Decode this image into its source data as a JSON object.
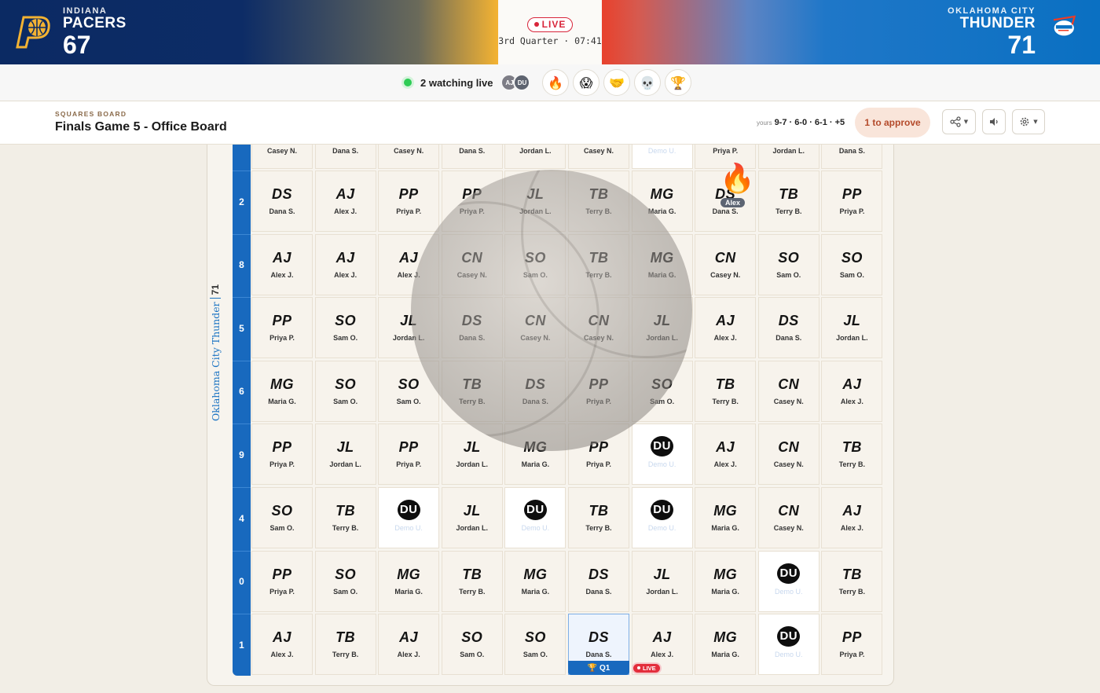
{
  "scoreboard": {
    "home": {
      "city": "INDIANA",
      "name": "PACERS",
      "score": "67",
      "logo_icon": "pacers-logo-icon"
    },
    "away": {
      "city": "OKLAHOMA CITY",
      "name": "THUNDER",
      "score": "71",
      "logo_icon": "thunder-logo-icon"
    },
    "status": "LIVE",
    "period_clock": "3rd Quarter · 07:41"
  },
  "presence": {
    "watching_text": "2 watching live",
    "avatars": [
      "AJ",
      "DU"
    ],
    "reactions": [
      "🔥",
      "😱",
      "🤝",
      "💀",
      "🏆"
    ]
  },
  "header": {
    "eyebrow": "SQUARES BOARD",
    "title": "Finals Game 5 - Office Board",
    "yours_label": "yours",
    "yours_numbers": "9-7 · 6-0 · 6-1 · +5",
    "approve_label": "1  to approve"
  },
  "board": {
    "side_team": "Oklahoma City Thunder",
    "side_score": "71",
    "row_numbers": [
      "2",
      "8",
      "5",
      "6",
      "9",
      "4",
      "0",
      "1"
    ],
    "top_row_names": [
      "Casey N.",
      "Dana S.",
      "Casey N.",
      "Dana S.",
      "Jordan L.",
      "Casey N.",
      "Demo U.",
      "Priya P.",
      "Jordan L.",
      "Dana S."
    ],
    "rows": [
      [
        [
          "DS",
          "Dana S."
        ],
        [
          "AJ",
          "Alex J."
        ],
        [
          "PP",
          "Priya P."
        ],
        [
          "PP",
          "Priya P."
        ],
        [
          "JL",
          "Jordan L."
        ],
        [
          "TB",
          "Terry B."
        ],
        [
          "MG",
          "Maria G."
        ],
        [
          "DS",
          "Dana S."
        ],
        [
          "TB",
          "Terry B."
        ],
        [
          "PP",
          "Priya P."
        ]
      ],
      [
        [
          "AJ",
          "Alex J."
        ],
        [
          "AJ",
          "Alex J."
        ],
        [
          "AJ",
          "Alex J."
        ],
        [
          "CN",
          "Casey N."
        ],
        [
          "SO",
          "Sam O."
        ],
        [
          "TB",
          "Terry B."
        ],
        [
          "MG",
          "Maria G."
        ],
        [
          "CN",
          "Casey N."
        ],
        [
          "SO",
          "Sam O."
        ],
        [
          "SO",
          "Sam O."
        ]
      ],
      [
        [
          "PP",
          "Priya P."
        ],
        [
          "SO",
          "Sam O."
        ],
        [
          "JL",
          "Jordan L."
        ],
        [
          "DS",
          "Dana S."
        ],
        [
          "CN",
          "Casey N."
        ],
        [
          "CN",
          "Casey N."
        ],
        [
          "JL",
          "Jordan L."
        ],
        [
          "AJ",
          "Alex J."
        ],
        [
          "DS",
          "Dana S."
        ],
        [
          "JL",
          "Jordan L."
        ]
      ],
      [
        [
          "MG",
          "Maria G."
        ],
        [
          "SO",
          "Sam O."
        ],
        [
          "SO",
          "Sam O."
        ],
        [
          "TB",
          "Terry B."
        ],
        [
          "DS",
          "Dana S."
        ],
        [
          "PP",
          "Priya P."
        ],
        [
          "SO",
          "Sam O."
        ],
        [
          "TB",
          "Terry B."
        ],
        [
          "CN",
          "Casey N."
        ],
        [
          "AJ",
          "Alex J."
        ]
      ],
      [
        [
          "PP",
          "Priya P."
        ],
        [
          "JL",
          "Jordan L."
        ],
        [
          "PP",
          "Priya P."
        ],
        [
          "JL",
          "Jordan L."
        ],
        [
          "MG",
          "Maria G."
        ],
        [
          "PP",
          "Priya P."
        ],
        [
          "DU",
          "Demo U."
        ],
        [
          "AJ",
          "Alex J."
        ],
        [
          "CN",
          "Casey N."
        ],
        [
          "TB",
          "Terry B."
        ]
      ],
      [
        [
          "SO",
          "Sam O."
        ],
        [
          "TB",
          "Terry B."
        ],
        [
          "DU",
          "Demo U."
        ],
        [
          "JL",
          "Jordan L."
        ],
        [
          "DU",
          "Demo U."
        ],
        [
          "TB",
          "Terry B."
        ],
        [
          "DU",
          "Demo U."
        ],
        [
          "MG",
          "Maria G."
        ],
        [
          "CN",
          "Casey N."
        ],
        [
          "AJ",
          "Alex J."
        ]
      ],
      [
        [
          "PP",
          "Priya P."
        ],
        [
          "SO",
          "Sam O."
        ],
        [
          "MG",
          "Maria G."
        ],
        [
          "TB",
          "Terry B."
        ],
        [
          "MG",
          "Maria G."
        ],
        [
          "DS",
          "Dana S."
        ],
        [
          "JL",
          "Jordan L."
        ],
        [
          "MG",
          "Maria G."
        ],
        [
          "DU",
          "Demo U."
        ],
        [
          "TB",
          "Terry B."
        ]
      ],
      [
        [
          "AJ",
          "Alex J."
        ],
        [
          "TB",
          "Terry B."
        ],
        [
          "AJ",
          "Alex J."
        ],
        [
          "SO",
          "Sam O."
        ],
        [
          "SO",
          "Sam O."
        ],
        [
          "DS",
          "Dana S."
        ],
        [
          "AJ",
          "Alex J."
        ],
        [
          "MG",
          "Maria G."
        ],
        [
          "DU",
          "Demo U."
        ],
        [
          "PP",
          "Priya P."
        ]
      ]
    ],
    "reaction_emoji": "🔥",
    "reaction_user": "Alex",
    "winner_badge": "Q1",
    "live_badge": "LIVE"
  }
}
